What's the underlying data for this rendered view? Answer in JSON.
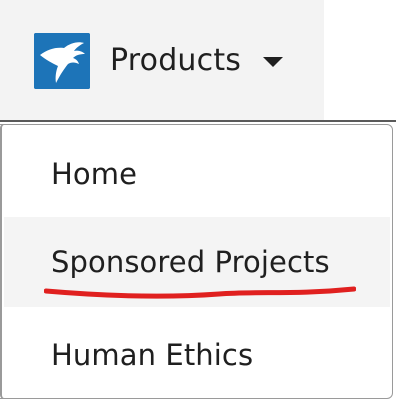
{
  "navbar": {
    "logo_icon": "hand-logo-icon",
    "logo_color": "#1d74b8",
    "products_label": "Products",
    "caret_icon": "caret-down-icon"
  },
  "dropdown": {
    "items": [
      {
        "label": "Home"
      },
      {
        "label": "Sponsored Projects",
        "highlighted": true,
        "annotation": "red-underline"
      },
      {
        "label": "Human Ethics"
      }
    ]
  },
  "colors": {
    "nav_background": "#f3f3f3",
    "hover_background": "#f4f4f4",
    "annotation_red": "#e0201f",
    "text": "#1f1f1f"
  }
}
